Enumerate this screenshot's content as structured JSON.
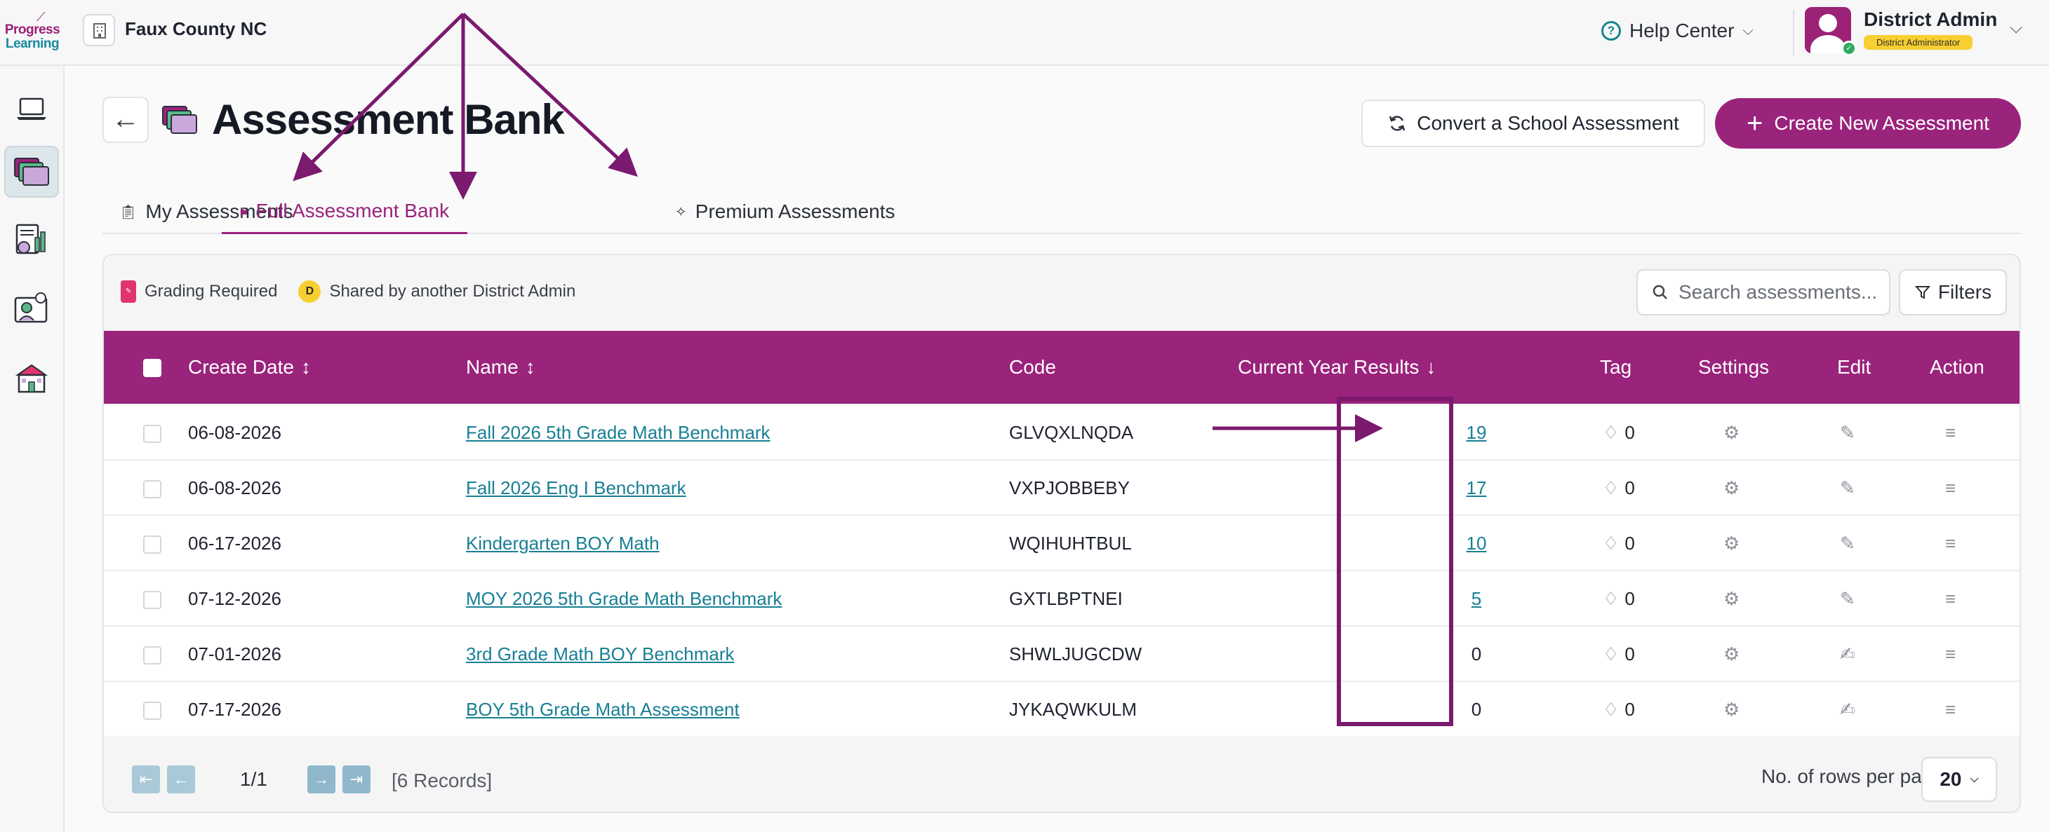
{
  "app": {
    "logo_line1": "Progress",
    "logo_line2": "Learning",
    "district": "Faux County NC"
  },
  "header": {
    "help_label": "Help Center",
    "user_name": "District Admin",
    "user_role": "District Administrator"
  },
  "page": {
    "title": "Assessment Bank",
    "convert_label": "Convert a School Assessment",
    "create_label": "Create New Assessment"
  },
  "tabs": [
    {
      "label": "My Assessments",
      "active": false
    },
    {
      "label": "Full Assessment Bank",
      "active": true
    },
    {
      "label": "Premium Assessments",
      "active": false
    }
  ],
  "legend": {
    "grading_required": "Grading Required",
    "shared_badge": "D",
    "shared_label": "Shared by another District Admin"
  },
  "toolbar": {
    "search_placeholder": "Search assessments...",
    "filters_label": "Filters"
  },
  "table": {
    "columns": {
      "create_date": "Create Date",
      "name": "Name",
      "code": "Code",
      "results": "Current Year Results",
      "tag": "Tag",
      "settings": "Settings",
      "edit": "Edit",
      "action": "Action"
    },
    "rows": [
      {
        "date": "06-08-2026",
        "name": "Fall 2026 5th Grade Math Benchmark",
        "code": "GLVQXLNQDA",
        "results": "19",
        "results_link": true,
        "tag": "0"
      },
      {
        "date": "06-08-2026",
        "name": "Fall 2026 Eng I Benchmark",
        "code": "VXPJOBBEBY",
        "results": "17",
        "results_link": true,
        "tag": "0"
      },
      {
        "date": "06-17-2026",
        "name": "Kindergarten BOY Math",
        "code": "WQIHUHTBUL",
        "results": "10",
        "results_link": true,
        "tag": "0"
      },
      {
        "date": "07-12-2026",
        "name": "MOY 2026 5th Grade Math Benchmark",
        "code": "GXTLBPTNEI",
        "results": "5",
        "results_link": true,
        "tag": "0"
      },
      {
        "date": "07-01-2026",
        "name": "3rd Grade Math BOY Benchmark",
        "code": "SHWLJUGCDW",
        "results": "0",
        "results_link": false,
        "tag": "0"
      },
      {
        "date": "07-17-2026",
        "name": "BOY 5th Grade Math Assessment",
        "code": "JYKAQWKULM",
        "results": "0",
        "results_link": false,
        "tag": "0"
      }
    ]
  },
  "pagination": {
    "page": "1/1",
    "records": "[6 Records]",
    "rows_per_page_label": "No. of rows per page",
    "rows_per_page": "20"
  },
  "colors": {
    "brand": "#9a237c",
    "link": "#177f95",
    "annotation": "#7b1a6e"
  }
}
